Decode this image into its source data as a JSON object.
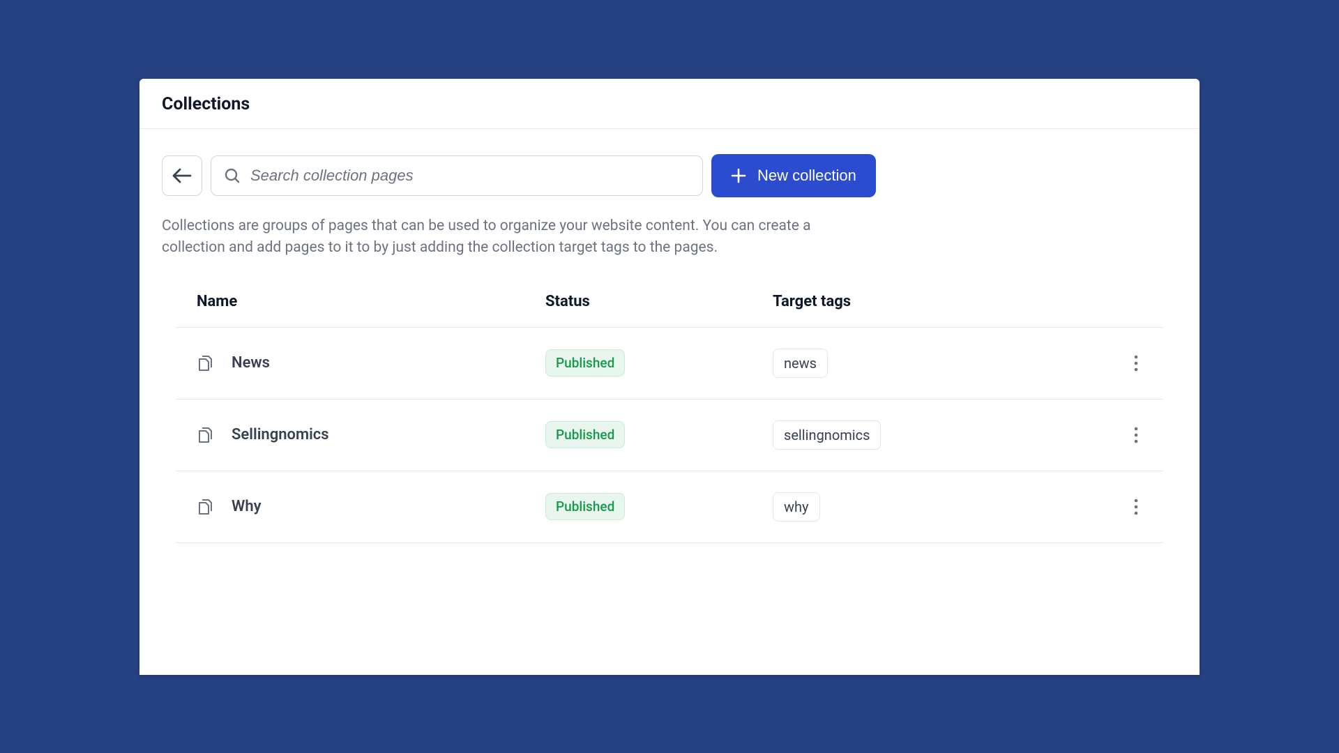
{
  "header": {
    "title": "Collections"
  },
  "toolbar": {
    "search_placeholder": "Search collection pages",
    "new_collection_label": "New collection"
  },
  "description": "Collections are groups of pages that can be used to organize your website content. You can create a collection and add pages to it to by just adding the collection target tags to the pages.",
  "table": {
    "columns": {
      "name": "Name",
      "status": "Status",
      "tags": "Target tags"
    },
    "rows": [
      {
        "name": "News",
        "status": "Published",
        "tag": "news"
      },
      {
        "name": "Sellingnomics",
        "status": "Published",
        "tag": "sellingnomics"
      },
      {
        "name": "Why",
        "status": "Published",
        "tag": "why"
      }
    ]
  },
  "colors": {
    "background": "#264182",
    "primary": "#2b4ccf",
    "status_green": "#159a4a"
  }
}
